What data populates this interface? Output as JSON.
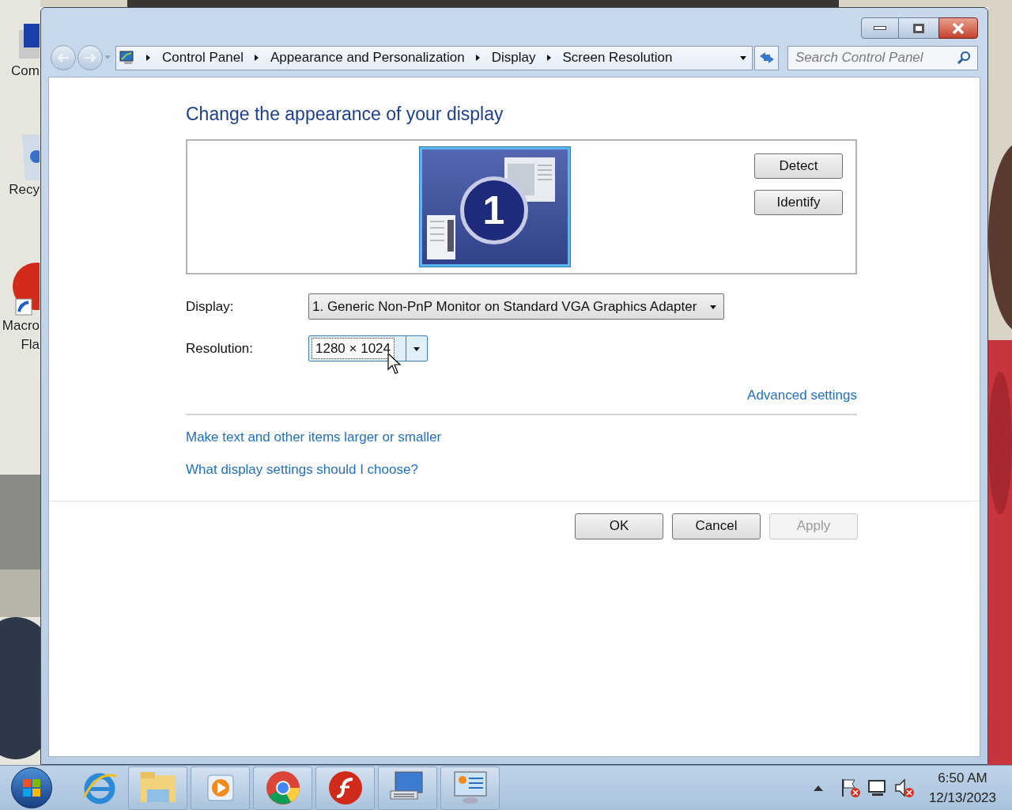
{
  "desktop_icons": [
    {
      "lines": [
        "Com"
      ]
    },
    {
      "lines": [
        "Recy"
      ]
    },
    {
      "lines": [
        "Macro",
        "Fla"
      ]
    }
  ],
  "address_bar": {
    "crumbs": [
      "Control Panel",
      "Appearance and Personalization",
      "Display",
      "Screen Resolution"
    ]
  },
  "search": {
    "placeholder": "Search Control Panel"
  },
  "heading": "Change the appearance of your display",
  "monitor": {
    "number": "1",
    "selected": true
  },
  "monitor_buttons": [
    "Detect",
    "Identify"
  ],
  "fields": [
    {
      "label": "Display:",
      "value": "1. Generic Non-PnP Monitor on Standard VGA Graphics Adapter",
      "focused": false
    },
    {
      "label": "Resolution:",
      "value": "1280 × 1024",
      "focused": true
    }
  ],
  "advanced_link": "Advanced settings",
  "links": [
    "Make text and other items larger or smaller",
    "What display settings should I choose?"
  ],
  "dialog_buttons": [
    {
      "label": "OK",
      "disabled": false
    },
    {
      "label": "Cancel",
      "disabled": false
    },
    {
      "label": "Apply",
      "disabled": true
    }
  ],
  "clock": {
    "time": "6:50 AM",
    "date": "12/13/2023"
  }
}
